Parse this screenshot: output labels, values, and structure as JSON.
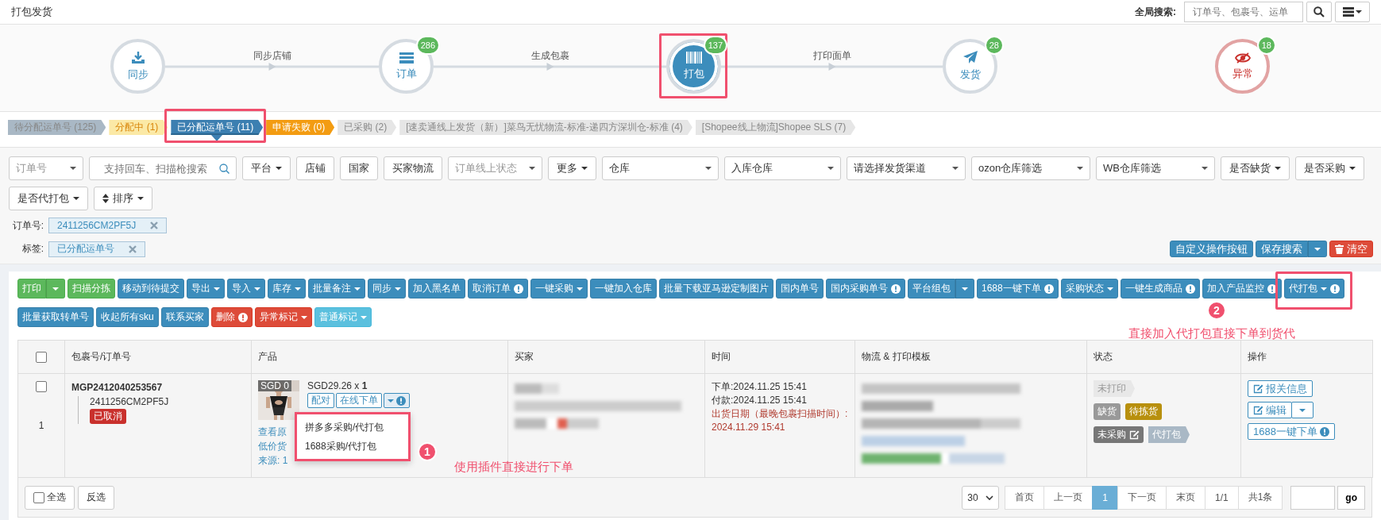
{
  "header": {
    "title": "打包发货",
    "search_label": "全局搜索:",
    "search_placeholder": "订单号、包裹号、运单"
  },
  "stepper": {
    "steps": [
      {
        "label": "同步",
        "selected": false,
        "kind": "normal",
        "highlighted": false
      },
      {
        "label": "订单",
        "count": "286",
        "selected": false,
        "kind": "normal",
        "highlighted": false
      },
      {
        "label": "打包",
        "count": "137",
        "selected": true,
        "kind": "normal",
        "highlighted": true
      },
      {
        "label": "发货",
        "count": "28",
        "selected": false,
        "kind": "normal",
        "highlighted": false
      },
      {
        "label": "异常",
        "count": "18",
        "selected": false,
        "kind": "danger",
        "highlighted": false
      }
    ],
    "links": [
      {
        "label": "同步店铺"
      },
      {
        "label": "生成包裹"
      },
      {
        "label": "打印面单"
      }
    ]
  },
  "status_tabs": [
    {
      "label": "待分配运单号 (125)",
      "color": "#a9b8c5",
      "selected": false,
      "highlighted": false
    },
    {
      "label": "分配中 (1)",
      "color": "#fbe9a6",
      "selected": false,
      "highlighted": false
    },
    {
      "label": "已分配运单号 (11)",
      "color": "#3c7fb1",
      "selected": true,
      "highlighted": true
    },
    {
      "label": "申请失败 (0)",
      "color": "#f39c12",
      "selected": false,
      "highlighted": false
    },
    {
      "label": "已采购 (2)",
      "color": "#e6e6e6",
      "selected": false,
      "highlighted": false
    },
    {
      "label": "[速卖通线上发货（新）]菜鸟无忧物流-标准-递四方深圳仓-标准 (4)",
      "color": "#e6e6e6",
      "selected": false,
      "highlighted": false
    },
    {
      "label": "[Shopee线上物流]Shopee SLS (7)",
      "color": "#e6e6e6",
      "selected": false,
      "highlighted": false
    }
  ],
  "filters": {
    "controls": [
      {
        "kind": "select",
        "placeholder": "订单号"
      },
      {
        "kind": "search",
        "placeholder": "支持回车、扫描枪搜索"
      },
      {
        "kind": "dropdown",
        "label": "平台"
      },
      {
        "kind": "button",
        "label": "店铺"
      },
      {
        "kind": "button",
        "label": "国家"
      },
      {
        "kind": "button",
        "label": "买家物流"
      },
      {
        "kind": "select",
        "placeholder": "订单线上状态"
      },
      {
        "kind": "dropdown",
        "label": "更多"
      },
      {
        "kind": "select",
        "value": "仓库"
      },
      {
        "kind": "select",
        "value": "入库仓库"
      },
      {
        "kind": "select",
        "value": "请选择发货渠道"
      },
      {
        "kind": "select",
        "value": "ozon仓库筛选"
      },
      {
        "kind": "select",
        "value": "WB仓库筛选"
      },
      {
        "kind": "dropdown",
        "label": "是否缺货"
      },
      {
        "kind": "dropdown",
        "label": "是否采购"
      },
      {
        "kind": "dropdown",
        "label": "是否代打包"
      },
      {
        "kind": "sort",
        "label": "排序"
      }
    ],
    "tags": [
      {
        "label": "订单号:",
        "value": "2411256CM2PF5J"
      },
      {
        "label": "标签:",
        "value": "已分配运单号"
      }
    ],
    "actions": [
      {
        "label": "自定义操作按钮",
        "kind": "primary",
        "split": false
      },
      {
        "label": "保存搜索",
        "kind": "primary",
        "split": true
      },
      {
        "label": "清空",
        "kind": "danger",
        "split": false
      }
    ]
  },
  "toolbar": {
    "buttons": [
      {
        "label": "打印",
        "kind": "success",
        "caret": false,
        "split": true,
        "alert": false,
        "highlighted": false
      },
      {
        "label": "扫描分拣",
        "kind": "success",
        "caret": false,
        "split": false,
        "alert": false,
        "highlighted": false
      },
      {
        "label": "移动到待提交",
        "kind": "primary",
        "caret": false,
        "split": false,
        "alert": false,
        "highlighted": false
      },
      {
        "label": "导出",
        "kind": "primary",
        "caret": true,
        "split": false,
        "alert": false,
        "highlighted": false
      },
      {
        "label": "导入",
        "kind": "primary",
        "caret": true,
        "split": false,
        "alert": false,
        "highlighted": false
      },
      {
        "label": "库存",
        "kind": "primary",
        "caret": true,
        "split": false,
        "alert": false,
        "highlighted": false
      },
      {
        "label": "批量备注",
        "kind": "primary",
        "caret": true,
        "split": false,
        "alert": false,
        "highlighted": false
      },
      {
        "label": "同步",
        "kind": "primary",
        "caret": true,
        "split": false,
        "alert": false,
        "highlighted": false
      },
      {
        "label": "加入黑名单",
        "kind": "primary",
        "caret": false,
        "split": false,
        "alert": false,
        "highlighted": false
      },
      {
        "label": "取消订单",
        "kind": "primary",
        "caret": false,
        "split": false,
        "alert": true,
        "highlighted": false
      },
      {
        "label": "一键采购",
        "kind": "primary",
        "caret": true,
        "split": false,
        "alert": false,
        "highlighted": false
      },
      {
        "label": "一键加入仓库",
        "kind": "primary",
        "caret": false,
        "split": false,
        "alert": false,
        "highlighted": false
      },
      {
        "label": "批量下载亚马逊定制图片",
        "kind": "primary",
        "caret": false,
        "split": false,
        "alert": false,
        "highlighted": false
      },
      {
        "label": "国内单号",
        "kind": "primary",
        "caret": false,
        "split": false,
        "alert": false,
        "highlighted": false
      },
      {
        "label": "国内采购单号",
        "kind": "primary",
        "caret": false,
        "split": false,
        "alert": true,
        "highlighted": false
      },
      {
        "label": "平台组包",
        "kind": "primary",
        "caret": false,
        "split": true,
        "alert": false,
        "highlighted": false
      },
      {
        "label": "1688一键下单",
        "kind": "primary",
        "caret": false,
        "split": false,
        "alert": true,
        "highlighted": false
      },
      {
        "label": "采购状态",
        "kind": "primary",
        "caret": true,
        "split": false,
        "alert": false,
        "highlighted": false
      },
      {
        "label": "一键生成商品",
        "kind": "primary",
        "caret": false,
        "split": false,
        "alert": true,
        "highlighted": false
      },
      {
        "label": "加入产品监控",
        "kind": "primary",
        "caret": false,
        "split": false,
        "alert": true,
        "highlighted": false
      },
      {
        "label": "代打包",
        "kind": "primary",
        "caret": true,
        "split": false,
        "alert": true,
        "highlighted": true
      },
      {
        "label": "批量获取转单号",
        "kind": "primary",
        "caret": false,
        "split": false,
        "alert": false,
        "highlighted": false
      },
      {
        "label": "收起所有sku",
        "kind": "primary",
        "caret": false,
        "split": false,
        "alert": false,
        "highlighted": false
      },
      {
        "label": "联系买家",
        "kind": "primary",
        "caret": false,
        "split": false,
        "alert": false,
        "highlighted": false
      },
      {
        "label": "删除",
        "kind": "danger",
        "caret": false,
        "split": false,
        "alert": true,
        "highlighted": false
      },
      {
        "label": "异常标记",
        "kind": "danger",
        "caret": true,
        "split": false,
        "alert": false,
        "highlighted": false
      },
      {
        "label": "普通标记",
        "kind": "info",
        "caret": true,
        "split": false,
        "alert": false,
        "highlighted": false
      }
    ],
    "note": {
      "number": "2",
      "text": "直接加入代打包直接下单到货代"
    }
  },
  "table": {
    "header_checked": false,
    "columns": [
      "包裹号/订单号",
      "产品",
      "买家",
      "时间",
      "物流 & 打印模板",
      "状态",
      "操作"
    ],
    "rows": [
      {
        "checked": false,
        "index": "1",
        "package_no": "MGP2412040253567",
        "order_no": "2411256CM2PF5J",
        "order_badge": "已取消",
        "product": {
          "image_badge": "SGD 0",
          "price": "SGD29.26 x **1**",
          "buttons": [
            "配对",
            "在线下单"
          ],
          "links": [
            "查看原",
            "低价货",
            "来源: 1"
          ],
          "menu": {
            "expanded": true,
            "items": [
              "拼多多采购/代打包",
              "1688采购/代打包"
            ],
            "highlighted": true
          },
          "note": {
            "number": "1",
            "text": "使用插件直接进行下单"
          }
        },
        "times": [
          {
            "text": "下单:2024.11.25 15:41",
            "kind": "normal"
          },
          {
            "text": "付款:2024.11.25 15:41",
            "kind": "normal"
          },
          {
            "text": "出货日期（最晚包裹扫描时间）:",
            "kind": "alert"
          },
          {
            "text": "2024.11.29 15:41",
            "kind": "alert"
          }
        ],
        "status_rows": [
          [
            {
              "label": "未打印",
              "kind": "ribbon",
              "color": "#e8e8e8",
              "edit": false
            }
          ],
          [
            {
              "label": "缺货",
              "kind": "badge",
              "color": "#999999",
              "edit": false
            },
            {
              "label": "待拣货",
              "kind": "badge",
              "color": "#b8900e",
              "edit": false
            }
          ],
          [
            {
              "label": "未采购",
              "kind": "badge",
              "color": "#777777",
              "edit": true
            },
            {
              "label": "代打包",
              "kind": "ribbon",
              "color": "#a9b8c5",
              "edit": false
            }
          ]
        ],
        "actions": [
          {
            "label": "报关信息",
            "kind": "edit",
            "split": false
          },
          {
            "label": "编辑",
            "kind": "edit",
            "split": true
          },
          {
            "label": "1688一键下单",
            "kind": "alert",
            "split": false
          }
        ]
      }
    ]
  },
  "pagination": {
    "select_all": {
      "label": "全选",
      "checked": false
    },
    "invert": "反选",
    "page_size": "30",
    "pages": [
      {
        "label": "首页",
        "selected": false
      },
      {
        "label": "上一页",
        "selected": false
      },
      {
        "label": "1",
        "selected": true
      },
      {
        "label": "下一页",
        "selected": false
      },
      {
        "label": "末页",
        "selected": false
      },
      {
        "label": "1/1",
        "selected": false
      },
      {
        "label": "共1条",
        "selected": false
      }
    ],
    "go": "go"
  }
}
